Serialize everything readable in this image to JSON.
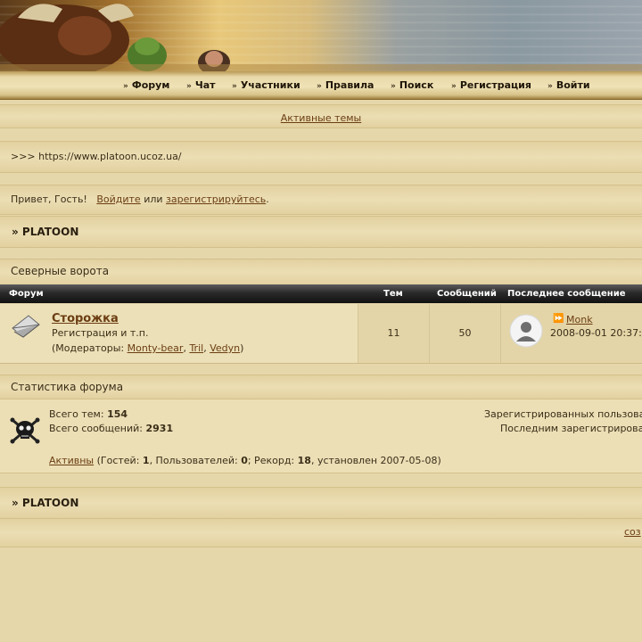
{
  "nav": {
    "items": [
      {
        "label": "Форум"
      },
      {
        "label": "Чат"
      },
      {
        "label": "Участники"
      },
      {
        "label": "Правила"
      },
      {
        "label": "Поиск"
      },
      {
        "label": "Регистрация"
      },
      {
        "label": "Войти"
      }
    ]
  },
  "active_topics": "Активные темы",
  "site_url": ">>> https://www.platoon.ucoz.ua/",
  "greeting": {
    "prefix": "Привет, Гость!",
    "login": "Войдите",
    "or": "или",
    "register": "зарегистрируйтесь",
    "suffix": "."
  },
  "section_title": "» PLATOON",
  "category": "Северные ворота",
  "table": {
    "headers": {
      "forum": "Форум",
      "topics": "Тем",
      "posts": "Сообщений",
      "last": "Последнее сообщение"
    },
    "row": {
      "name": "Сторожка",
      "desc": "Регистрация и т.п.",
      "mods_label": "(Модераторы:",
      "mods": [
        "Monty-bear",
        "Tril",
        "Vedyn"
      ],
      "mods_close": ")",
      "topics": "11",
      "posts": "50",
      "last_user": "Monk",
      "last_time": "2008-09-01 20:37:"
    }
  },
  "stats": {
    "title": "Статистика форума",
    "topics_label": "Всего тем:",
    "topics_value": "154",
    "posts_label": "Всего сообщений:",
    "posts_value": "2931",
    "registered_label": "Зарегистрированных пользова",
    "last_registered_label": "Последним зарегистрирова",
    "active_link": "Активны",
    "guests_label": "(Гостей:",
    "guests_value": "1",
    "users_label": ", Пользователей:",
    "users_value": "0",
    "record_label": "; Рекорд:",
    "record_value": "18",
    "record_date": ", установлен 2007-05-08)"
  },
  "footer": {
    "title": "» PLATOON",
    "right_link": "соз"
  },
  "colors": {
    "background": "#e6d7ab",
    "link": "#6b3d12",
    "table_header": "#222222"
  }
}
